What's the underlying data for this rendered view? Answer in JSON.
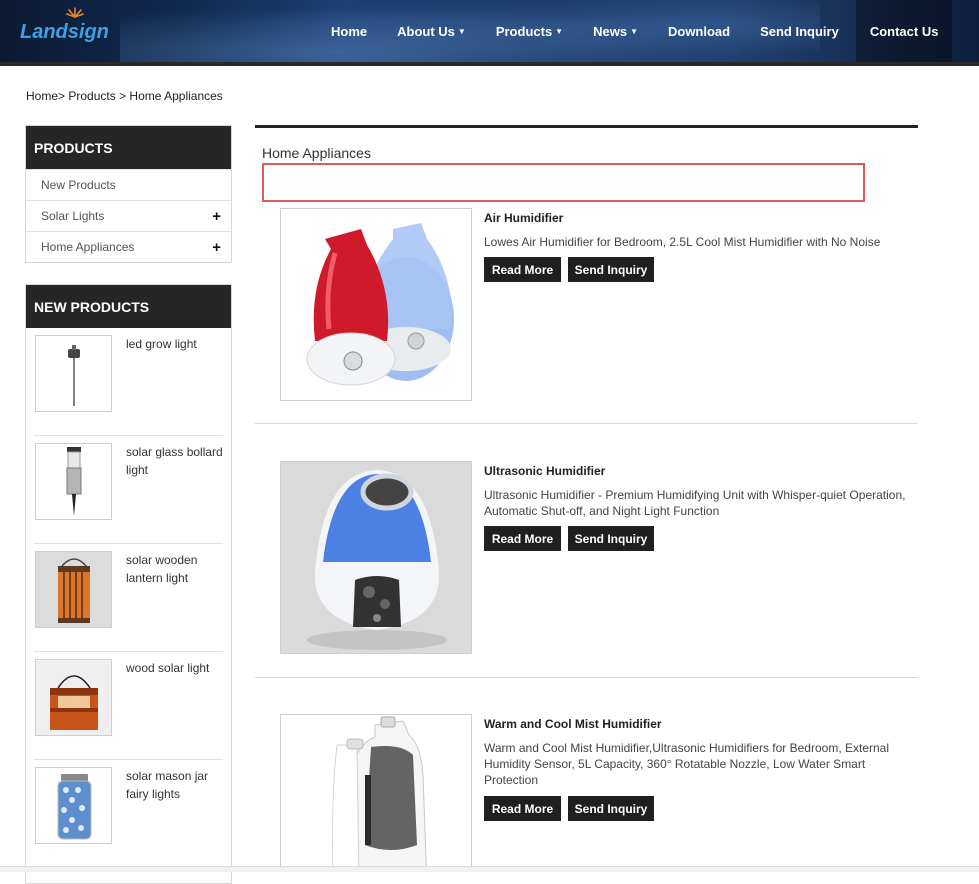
{
  "brand": {
    "logo_text": "Landsign"
  },
  "nav": {
    "items": [
      {
        "label": "Home",
        "caret": ""
      },
      {
        "label": "About Us",
        "caret": "▼"
      },
      {
        "label": "Products",
        "caret": "▼"
      },
      {
        "label": "News",
        "caret": "▼"
      },
      {
        "label": "Download",
        "caret": ""
      },
      {
        "label": "Send Inquiry",
        "caret": ""
      },
      {
        "label": "Contact Us",
        "caret": ""
      }
    ]
  },
  "breadcrumb": {
    "home": "Home",
    "sep1": ">",
    "products": " Products",
    "sep2": " > ",
    "current": "Home Appliances"
  },
  "sidebar": {
    "products_heading": "PRODUCTS",
    "categories": [
      {
        "label": "New Products",
        "expand": ""
      },
      {
        "label": "Solar Lights",
        "expand": "+"
      },
      {
        "label": "Home Appliances",
        "expand": "+"
      }
    ],
    "new_products_heading": "NEW PRODUCTS",
    "new_products": [
      {
        "title": "led grow light"
      },
      {
        "title": "solar glass bollard light"
      },
      {
        "title": "solar wooden lantern light"
      },
      {
        "title": "wood solar light"
      },
      {
        "title": "solar mason jar fairy lights"
      }
    ]
  },
  "main": {
    "title": "Home Appliances",
    "products": [
      {
        "name": "Air Humidifier",
        "desc": "Lowes Air Humidifier for Bedroom, 2.5L Cool Mist Humidifier with No Noise",
        "read_more": "Read More",
        "inquiry": "Send Inquiry"
      },
      {
        "name": "Ultrasonic Humidifier",
        "desc": "Ultrasonic Humidifier - Premium Humidifying Unit with Whisper-quiet Operation, Automatic Shut-off, and Night Light Function",
        "read_more": "Read More",
        "inquiry": "Send Inquiry"
      },
      {
        "name": "Warm and Cool Mist Humidifier",
        "desc": "Warm and Cool Mist Humidifier,Ultrasonic Humidifiers for Bedroom, External Humidity Sensor, 5L Capacity, 360° Rotatable Nozzle, Low Water Smart Protection",
        "read_more": "Read More",
        "inquiry": "Send Inquiry"
      }
    ]
  },
  "colors": {
    "header": "#10294f",
    "dark": "#262626",
    "highlight_border": "#e05a5a",
    "logo": "#3fa0e6"
  }
}
